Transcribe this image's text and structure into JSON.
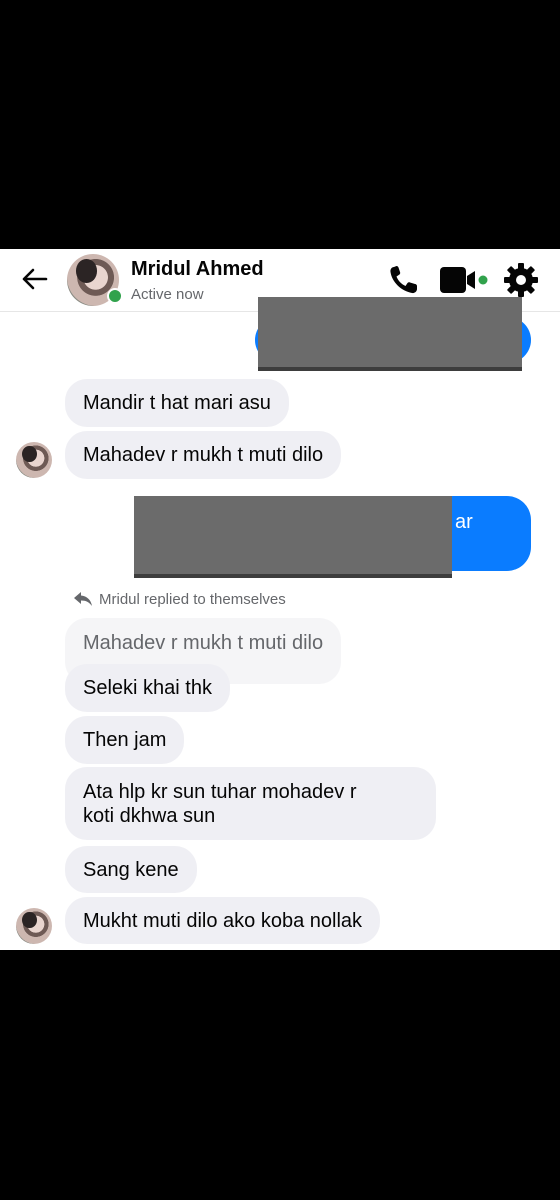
{
  "header": {
    "contact_name": "Mridul Ahmed",
    "status": "Active now",
    "icons": [
      "back-arrow-icon",
      "phone-icon",
      "video-camera-icon",
      "gear-icon"
    ],
    "presence_color": "#31a24c"
  },
  "messages": {
    "sent_1_text": "",
    "m1": "Mandir t hat mari asu",
    "m2": "Mahadev r mukh t muti dilo",
    "sent_2_visible_fragment": "ar",
    "reply_note": "Mridul replied to themselves",
    "quoted": "Mahadev r mukh t muti dilo",
    "m3": "Seleki khai thk",
    "m4": "Then jam",
    "m5_line1": "Ata hlp kr sun tuhar mohadev r",
    "m5_line2": "koti dkhwa sun",
    "m6": "Sang kene",
    "m7": "Mukht muti dilo ako koba nollak"
  },
  "colors": {
    "sent_bubble": "#0a7cff",
    "received_bubble": "#efeff4",
    "redaction": "#6b6b6b"
  }
}
